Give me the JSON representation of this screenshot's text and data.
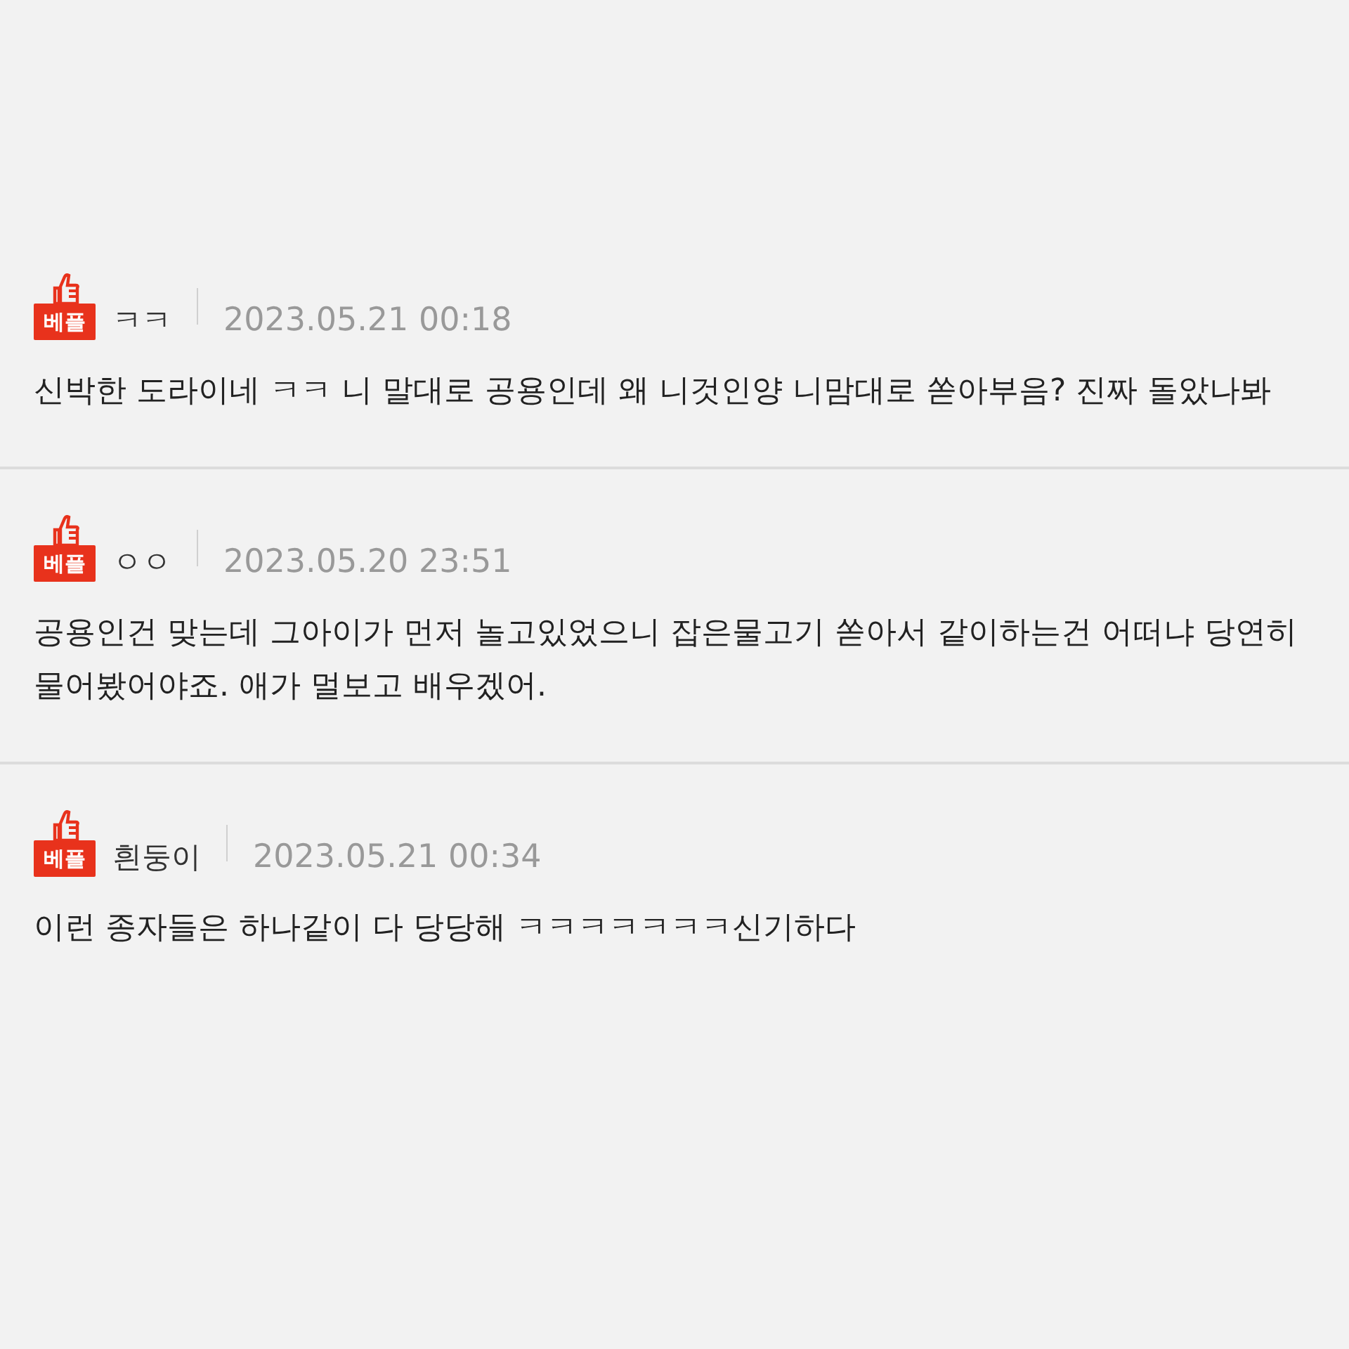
{
  "comments": [
    {
      "badge": "베플",
      "author": "ㅋㅋ",
      "date": "2023.05.21 00:18",
      "text": "신박한 도라이네 ㅋㅋ 니 말대로 공용인데 왜 니것인양 니맘대로 쏟아부음? 진짜 돌았나봐"
    },
    {
      "badge": "베플",
      "author": "ㅇㅇ",
      "date": "2023.05.20 23:51",
      "text": "공용인건 맞는데 그아이가 먼저 놀고있었으니 잡은물고기 쏟아서 같이하는건 어떠냐 당연히 물어봤어야죠. 애가 멀보고 배우겠어."
    },
    {
      "badge": "베플",
      "author": "흰둥이",
      "date": "2023.05.21 00:34",
      "text": "이런 종자들은 하나같이 다 당당해 ㅋㅋㅋㅋㅋㅋㅋ신기하다"
    }
  ]
}
